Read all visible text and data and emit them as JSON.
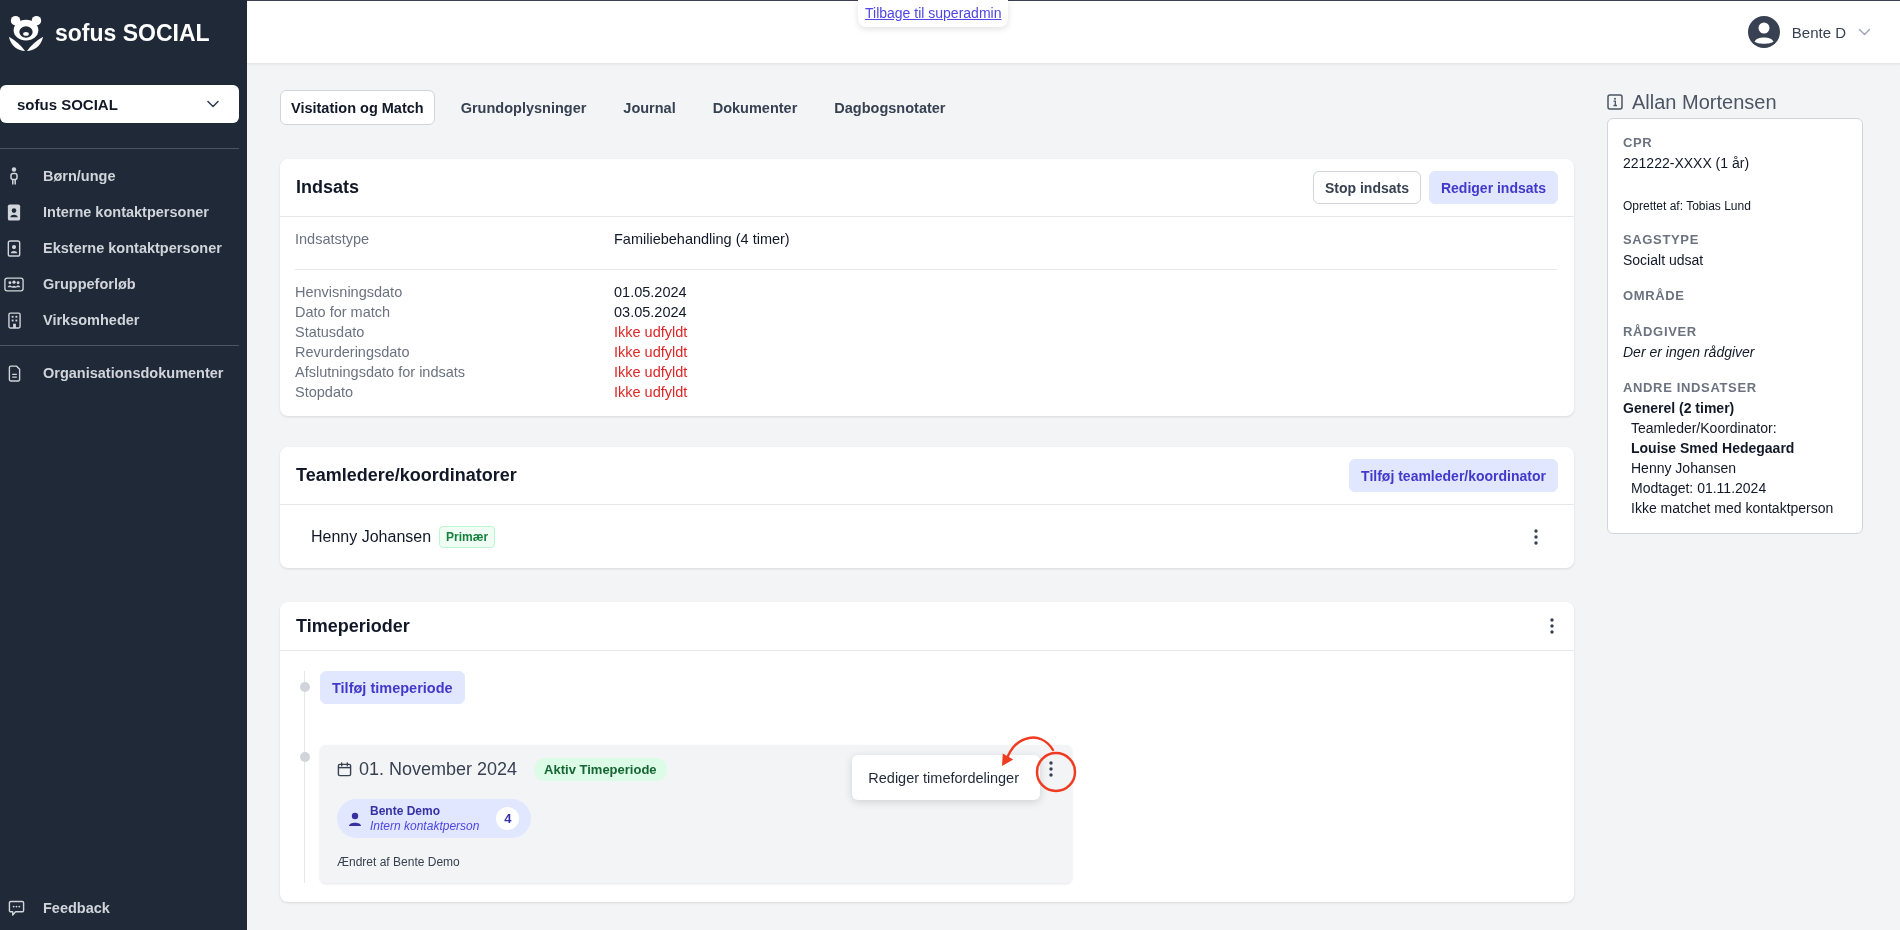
{
  "sidebar": {
    "logo_text": "sofus SOCIAL",
    "org_select": "sofus SOCIAL",
    "nav_groups": [
      {
        "items": [
          {
            "label": "Børn/unge",
            "selected": false
          },
          {
            "label": "Interne kontaktpersoner",
            "selected": false
          },
          {
            "label": "Eksterne kontaktpersoner",
            "selected": false
          },
          {
            "label": "Gruppeforløb",
            "selected": false
          },
          {
            "label": "Virksomheder",
            "selected": false
          }
        ]
      },
      {
        "items": [
          {
            "label": "Organisationsdokumenter",
            "selected": false
          }
        ]
      }
    ],
    "footer_items": [
      {
        "label": "Feedback"
      }
    ]
  },
  "top_bar": {
    "back_link": "Tilbage til superadmin",
    "user_name": "Bente D"
  },
  "tabs": [
    {
      "label": "Visitation og Match",
      "selected": true
    },
    {
      "label": "Grundoplysninger",
      "selected": false
    },
    {
      "label": "Journal",
      "selected": false
    },
    {
      "label": "Dokumenter",
      "selected": false
    },
    {
      "label": "Dagbogsnotater",
      "selected": false
    }
  ],
  "indsats": {
    "title": "Indsats",
    "buttons": [
      {
        "label": "Stop indsats",
        "kind": "outline"
      },
      {
        "label": "Rediger indsats",
        "kind": "primary"
      }
    ],
    "type_row": {
      "label": "Indsatstype",
      "value": "Familiebehandling (4 timer)"
    },
    "date_rows": [
      {
        "label": "Henvisningsdato",
        "value": "01.05.2024",
        "missing": false
      },
      {
        "label": "Dato for match",
        "value": "03.05.2024",
        "missing": false
      },
      {
        "label": "Statusdato",
        "value": "Ikke udfyldt",
        "missing": true
      },
      {
        "label": "Revurderingsdato",
        "value": "Ikke udfyldt",
        "missing": true
      },
      {
        "label": "Afslutningsdato for indsats",
        "value": "Ikke udfyldt",
        "missing": true
      },
      {
        "label": "Stopdato",
        "value": "Ikke udfyldt",
        "missing": true
      }
    ]
  },
  "teamledere": {
    "title": "Teamledere/koordinatorer",
    "button": "Tilføj teamleder/koordinator",
    "members": [
      {
        "name": "Henny Johansen",
        "badge": "Primær"
      }
    ]
  },
  "timeperioder": {
    "title": "Timeperioder",
    "add_button": "Tilføj timeperiode",
    "periods": [
      {
        "date": "01. November 2024",
        "status": "Aktiv Timeperiode",
        "assignees": [
          {
            "name": "Bente Demo",
            "role": "Intern kontaktperson",
            "count": "4"
          }
        ],
        "changed_by": "Ændret af Bente Demo",
        "menu_open": true,
        "menu_items": [
          "Rediger timefordelinger"
        ],
        "highlighted": true
      }
    ]
  },
  "case_info": {
    "name": "Allan Mortensen",
    "fields": [
      {
        "label": "CPR",
        "value": "221222-XXXX (1 år)",
        "note": "Oprettet af: Tobias Lund"
      },
      {
        "label": "SAGSTYPE",
        "value": "Socialt udsat"
      },
      {
        "label": "OMRÅDE"
      },
      {
        "label": "RÅDGIVER",
        "empty_text": "Der er ingen rådgiver"
      },
      {
        "label": "ANDRE INDSATSER",
        "efforts": [
          {
            "title": "Generel (2 timer)",
            "lines": [
              {
                "text": "Teamleder/Koordinator:",
                "bold": false
              },
              {
                "text": "Louise Smed Hedegaard",
                "bold": true
              },
              {
                "text": "Henny Johansen",
                "bold": false
              },
              {
                "text": "Modtaget: 01.11.2024",
                "bold": false
              },
              {
                "text": "Ikke matchet med kontaktperson",
                "bold": false
              }
            ]
          }
        ]
      }
    ]
  }
}
